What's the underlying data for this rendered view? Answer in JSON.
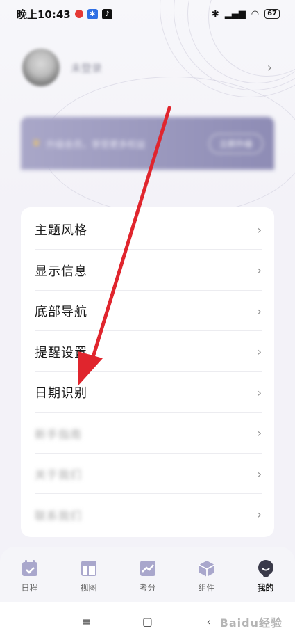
{
  "status_bar": {
    "time": "晚上10:43",
    "battery": "67"
  },
  "profile": {
    "name": "未登录"
  },
  "banner": {
    "text": "升级会员，享受更多权益",
    "button": "立即升级"
  },
  "menu": {
    "items": [
      {
        "label": "主题风格",
        "blurred": false
      },
      {
        "label": "显示信息",
        "blurred": false
      },
      {
        "label": "底部导航",
        "blurred": false
      },
      {
        "label": "提醒设置",
        "blurred": false
      },
      {
        "label": "日期识别",
        "blurred": false
      },
      {
        "label": "新手指南",
        "blurred": true
      },
      {
        "label": "关于我们",
        "blurred": true
      },
      {
        "label": "联系我们",
        "blurred": true
      }
    ]
  },
  "bottom_nav": {
    "items": [
      {
        "label": "日程",
        "icon": "calendar-icon"
      },
      {
        "label": "视图",
        "icon": "layout-icon"
      },
      {
        "label": "考分",
        "icon": "chart-icon"
      },
      {
        "label": "组件",
        "icon": "cube-icon"
      },
      {
        "label": "我的",
        "icon": "profile-icon",
        "active": true
      }
    ]
  },
  "watermark": "Baidu经验",
  "colors": {
    "accent": "#a9a7cc",
    "arrow": "#e0252d",
    "banner": "#9896bd"
  }
}
